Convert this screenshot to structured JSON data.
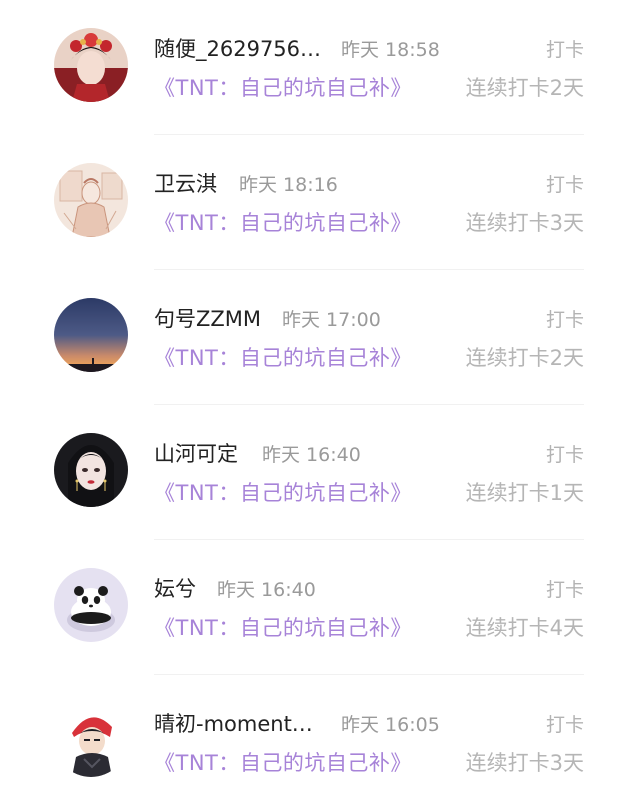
{
  "feed": {
    "items": [
      {
        "name": "随便_2629756…",
        "time": "昨天 18:58",
        "tag": "打卡",
        "book": "《TNT：自己的坑自己补》",
        "streak": "连续打卡2天",
        "avatar_icon": "avatar-girl-red-headdress"
      },
      {
        "name": "卫云淇",
        "time": "昨天 18:16",
        "tag": "打卡",
        "book": "《TNT：自己的坑自己补》",
        "streak": "连续打卡3天",
        "avatar_icon": "avatar-sketch-figure"
      },
      {
        "name": "句号ZZMM",
        "time": "昨天 17:00",
        "tag": "打卡",
        "book": "《TNT：自己的坑自己补》",
        "streak": "连续打卡2天",
        "avatar_icon": "avatar-sunset-sky"
      },
      {
        "name": "山河可定",
        "time": "昨天 16:40",
        "tag": "打卡",
        "book": "《TNT：自己的坑自己补》",
        "streak": "连续打卡1天",
        "avatar_icon": "avatar-anime-girl"
      },
      {
        "name": "妘兮",
        "time": "昨天 16:40",
        "tag": "打卡",
        "book": "《TNT：自己的坑自己补》",
        "streak": "连续打卡4天",
        "avatar_icon": "avatar-panda"
      },
      {
        "name": "晴初-moment…",
        "time": "昨天 16:05",
        "tag": "打卡",
        "book": "《TNT：自己的坑自己补》",
        "streak": "连续打卡3天",
        "avatar_icon": "avatar-cartoon-boy"
      }
    ]
  },
  "colors": {
    "book_accent": "#a783d8",
    "name": "#222222",
    "muted": "#9a9a9a"
  }
}
